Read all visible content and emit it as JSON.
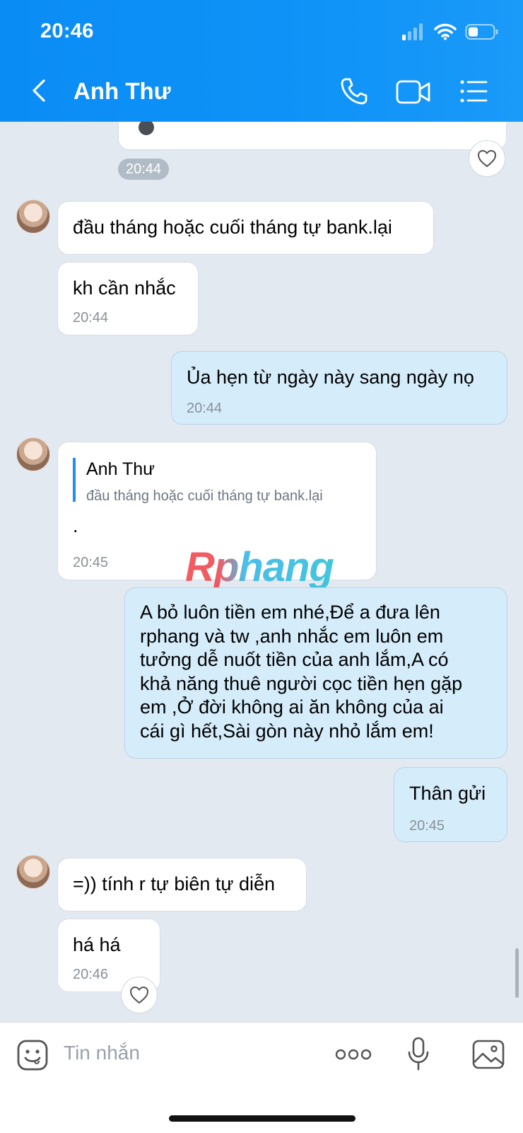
{
  "status": {
    "time": "20:46"
  },
  "header": {
    "title": "Anh Thư"
  },
  "messages": {
    "top_time": "20:44",
    "m1": {
      "text": "đầu tháng hoặc cuối tháng tự bank.lại"
    },
    "m2": {
      "text": "kh cần nhắc",
      "time": "20:44"
    },
    "m3": {
      "text": "Ủa hẹn từ ngày này sang ngày nọ",
      "time": "20:44"
    },
    "m4": {
      "reply_name": "Anh Thư",
      "reply_text": "đầu tháng hoặc cuối tháng tự bank.lại",
      "text": ".",
      "time": "20:45"
    },
    "m5": {
      "lines": [
        "A bỏ luôn tiền em nhé,Để a đưa lên",
        "rphang và tw ,anh nhắc em luôn em",
        "tưởng dễ nuốt tiền của anh lắm,A có",
        "khả năng thuê người cọc tiền hẹn gặp",
        "em ,Ở đời không ai ăn không của ai",
        "cái gì hết,Sài gòn này nhỏ lắm em!"
      ]
    },
    "m6": {
      "text": "Thân gửi",
      "time": "20:45"
    },
    "m7": {
      "text": "=)) tính r tự biên tự diễn"
    },
    "m8": {
      "text": "há há",
      "time": "20:46"
    }
  },
  "watermark": "Rphang",
  "input": {
    "placeholder": "Tin nhắn"
  },
  "colors": {
    "header": "#0f93f7",
    "incoming": "#ffffff",
    "outgoing": "#d5ecfb",
    "background": "#e2e9f1"
  }
}
